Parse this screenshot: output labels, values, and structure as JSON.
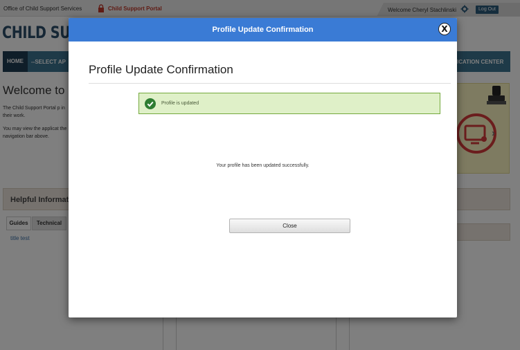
{
  "header": {
    "org_link": "Office of Child Support Services",
    "portal_name": "Child Support Portal",
    "welcome": "Welcome Cheryl Stachlinski",
    "logout": "Log Out"
  },
  "brand": {
    "partial_title": "CHILD SUPPO"
  },
  "nav": {
    "home": "HOME",
    "select_app": "--SELECT AP",
    "right_partial": "ICATION CENTER"
  },
  "main": {
    "welcome_heading": "Welcome to",
    "intro_p1": "The Child Support Portal p in their work.",
    "intro_p2": "You may view the applicat the navigation bar above."
  },
  "helpful": {
    "title": "Helpful Informat",
    "tabs": [
      "Guides",
      "Technical"
    ],
    "link": "title test"
  },
  "modal": {
    "titlebar": "Profile Update Confirmation",
    "close_icon_label": "X",
    "heading": "Profile Update Confirmation",
    "alert_text": "Profile is updated",
    "message": "Your profile has been updated successfully.",
    "close_button": "Close"
  },
  "icons": {
    "lock": "lock-icon",
    "gear": "gear-icon",
    "check": "check-circle-icon",
    "close": "close-icon",
    "stamp": "stamp-icon",
    "computer_gear": "computer-gear-icon",
    "chevron": "chevron-right-icon"
  },
  "colors": {
    "titlebar": "#3a7bd5",
    "alert_bg": "#dff0c8",
    "alert_border": "#73a83c",
    "check": "#2e7d32",
    "nav": "#3d7590",
    "portal_red": "#c0392b"
  }
}
